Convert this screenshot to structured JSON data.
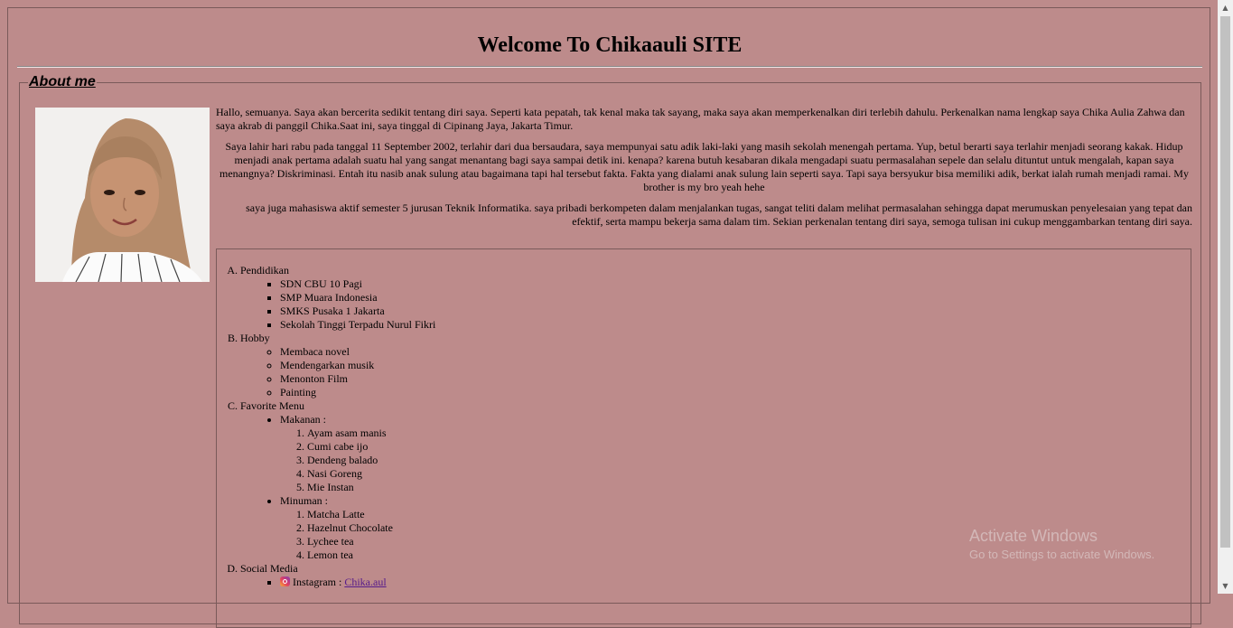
{
  "site": {
    "title": "Welcome To Chikaauli SITE"
  },
  "about": {
    "legend": "About me",
    "photo_alt": "profile-photo",
    "paragraphs": [
      "Hallo, semuanya. Saya akan bercerita sedikit tentang diri saya. Seperti kata pepatah, tak kenal maka tak sayang, maka saya akan memperkenalkan diri terlebih dahulu. Perkenalkan nama lengkap saya Chika Aulia Zahwa dan saya akrab di panggil Chika.Saat ini, saya tinggal di Cipinang Jaya, Jakarta Timur.",
      "Saya lahir hari rabu pada tanggal 11 September 2002, terlahir dari dua bersaudara, saya mempunyai satu adik laki-laki yang masih sekolah menengah pertama. Yup, betul berarti saya terlahir menjadi seorang kakak. Hidup menjadi anak pertama adalah suatu hal yang sangat menantang bagi saya sampai detik ini. kenapa? karena butuh kesabaran dikala mengadapi suatu permasalahan sepele dan selalu dituntut untuk mengalah, kapan saya menangnya? Diskriminasi. Entah itu nasib anak sulung atau bagaimana tapi hal tersebut fakta. Fakta yang dialami anak sulung lain seperti saya. Tapi saya bersyukur bisa memiliki adik, berkat ialah rumah menjadi ramai. My brother is my bro yeah hehe",
      "saya juga mahasiswa aktif semester 5 jurusan Teknik Informatika. saya pribadi berkompeten dalam menjalankan tugas, sangat teliti dalam melihat permasalahan sehingga dapat merumuskan penyelesaian yang tepat dan efektif, serta mampu bekerja sama dalam tim. Sekian perkenalan tentang diri saya, semoga tulisan ini cukup menggambarkan tentang diri saya."
    ]
  },
  "lists": {
    "pendidikan": {
      "label": "Pendidikan",
      "items": [
        "SDN CBU 10 Pagi",
        "SMP Muara Indonesia",
        "SMKS Pusaka 1 Jakarta",
        "Sekolah Tinggi Terpadu Nurul Fikri"
      ]
    },
    "hobby": {
      "label": "Hobby",
      "items": [
        "Membaca novel",
        "Mendengarkan musik",
        "Menonton Film",
        "Painting"
      ]
    },
    "menu": {
      "label": "Favorite Menu",
      "makanan": {
        "label": "Makanan :",
        "items": [
          "Ayam asam manis",
          "Cumi cabe ijo",
          "Dendeng balado",
          "Nasi Goreng",
          "Mie Instan"
        ]
      },
      "minuman": {
        "label": "Minuman :",
        "items": [
          "Matcha Latte",
          "Hazelnut Chocolate",
          "Lychee tea",
          "Lemon tea"
        ]
      }
    },
    "social": {
      "label": "Social Media",
      "instagram_label": "Instagram : ",
      "instagram_link": "Chika.aul"
    }
  },
  "watermark": {
    "line1": "Activate Windows",
    "line2": "Go to Settings to activate Windows."
  },
  "icons": {
    "instagram": "instagram-icon"
  }
}
